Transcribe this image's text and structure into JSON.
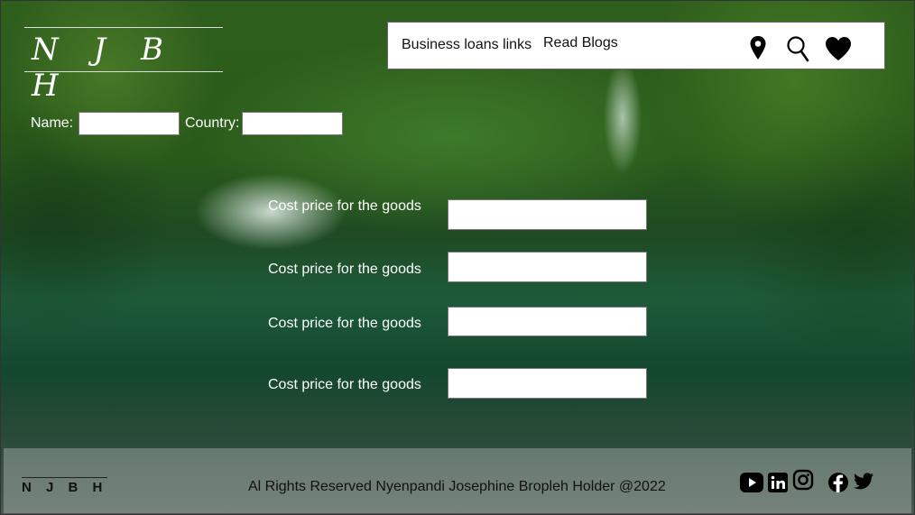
{
  "brand": {
    "logo_text": "N J B H",
    "footer_logo": "N J B H"
  },
  "nav": {
    "links": [
      "Business loans links",
      "Read Blogs"
    ],
    "icons": [
      "location-pin-icon",
      "search-icon",
      "heart-icon"
    ]
  },
  "form": {
    "name_label": "Name:",
    "country_label": "Country:",
    "name_value": "",
    "country_value": ""
  },
  "cost_rows": [
    {
      "label": "Cost price for the goods",
      "value": ""
    },
    {
      "label": "Cost price for the goods",
      "value": ""
    },
    {
      "label": "Cost price for the goods",
      "value": ""
    },
    {
      "label": "Cost price for the goods",
      "value": ""
    }
  ],
  "footer": {
    "copyright": "Al Rights Reserved Nyenpandi Josephine Bropleh Holder @2022",
    "social_icons": [
      "youtube-icon",
      "linkedin-icon",
      "instagram-icon",
      "facebook-icon",
      "twitter-icon"
    ]
  },
  "colors": {
    "accent_white": "#ffffff",
    "text_dark": "#111111"
  }
}
